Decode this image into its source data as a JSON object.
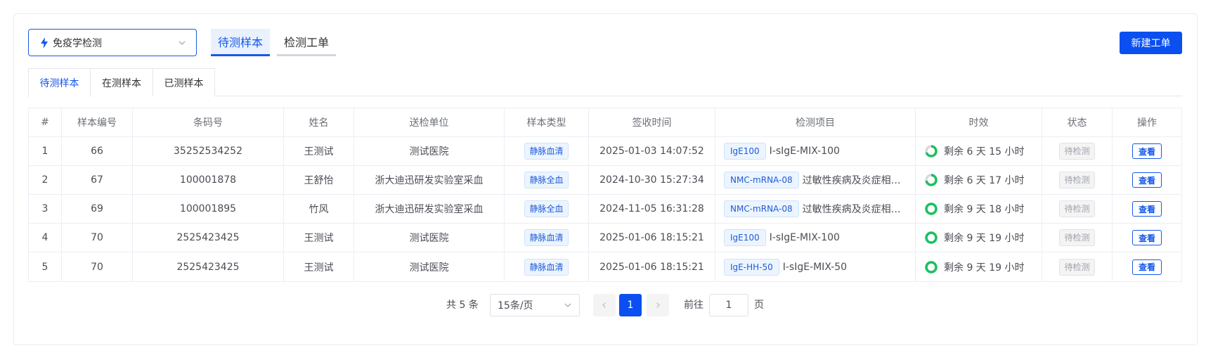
{
  "module_select": {
    "value": "免疫学检测",
    "icon": "bolt-icon"
  },
  "main_tabs": [
    {
      "label": "待测样本",
      "active": true
    },
    {
      "label": "检测工单",
      "active": false
    }
  ],
  "new_order_button": "新建工单",
  "sub_tabs": [
    {
      "label": "待测样本",
      "active": true
    },
    {
      "label": "在测样本",
      "active": false
    },
    {
      "label": "已测样本",
      "active": false
    }
  ],
  "table": {
    "columns": [
      "#",
      "样本编号",
      "条码号",
      "姓名",
      "送检单位",
      "样本类型",
      "签收时间",
      "检测项目",
      "时效",
      "状态",
      "操作"
    ],
    "rows": [
      {
        "idx": "1",
        "sample_no": "66",
        "barcode": "35252534252",
        "name": "王测试",
        "unit": "测试医院",
        "type": "静脉血清",
        "time": "2025-01-03 14:07:52",
        "item_tag": "IgE100",
        "item_text": "I-sIgE-MIX-100",
        "remaining": "剩余 6 天 15 小时",
        "ring_fraction": 0.7,
        "status": "待检测",
        "action": "查看"
      },
      {
        "idx": "2",
        "sample_no": "67",
        "barcode": "100001878",
        "name": "王舒怡",
        "unit": "浙大迪迅研发实验室采血",
        "type": "静脉全血",
        "time": "2024-10-30 15:27:34",
        "item_tag": "NMC-mRNA-08",
        "item_text": "过敏性疾病及炎症相关…",
        "remaining": "剩余 6 天 17 小时",
        "ring_fraction": 0.72,
        "status": "待检测",
        "action": "查看"
      },
      {
        "idx": "3",
        "sample_no": "69",
        "barcode": "100001895",
        "name": "竹风",
        "unit": "浙大迪迅研发实验室采血",
        "type": "静脉全血",
        "time": "2024-11-05 16:31:28",
        "item_tag": "NMC-mRNA-08",
        "item_text": "过敏性疾病及炎症相关…",
        "remaining": "剩余 9 天 18 小时",
        "ring_fraction": 1.0,
        "status": "待检测",
        "action": "查看"
      },
      {
        "idx": "4",
        "sample_no": "70",
        "barcode": "2525423425",
        "name": "王测试",
        "unit": "测试医院",
        "type": "静脉血清",
        "time": "2025-01-06 18:15:21",
        "item_tag": "IgE100",
        "item_text": "I-sIgE-MIX-100",
        "remaining": "剩余 9 天 19 小时",
        "ring_fraction": 1.0,
        "status": "待检测",
        "action": "查看"
      },
      {
        "idx": "5",
        "sample_no": "70",
        "barcode": "2525423425",
        "name": "王测试",
        "unit": "测试医院",
        "type": "静脉血清",
        "time": "2025-01-06 18:15:21",
        "item_tag": "IgE-HH-50",
        "item_text": "I-sIgE-MIX-50",
        "remaining": "剩余 9 天 19 小时",
        "ring_fraction": 1.0,
        "status": "待检测",
        "action": "查看"
      }
    ]
  },
  "pagination": {
    "total": "共 5 条",
    "page_size": "15条/页",
    "current_page": "1",
    "goto_label": "前往",
    "goto_value": "1",
    "page_suffix": "页"
  },
  "colors": {
    "primary": "#0b4ff0",
    "ring_green": "#19c160",
    "ring_track": "#d9d9d9"
  }
}
